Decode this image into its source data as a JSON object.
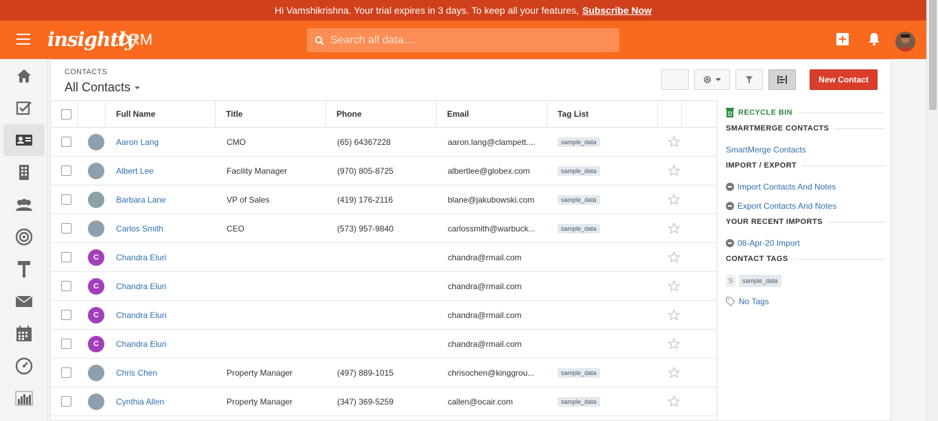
{
  "banner": {
    "message": "Hi Vamshikrishna. Your trial expires in 3 days. To keep all your features,",
    "cta": "Subscribe Now"
  },
  "header": {
    "logo": "insightly",
    "product": "CRM",
    "search_placeholder": "Search all data...."
  },
  "nav": {
    "items": [
      "home-icon",
      "tasks-icon",
      "contacts-icon",
      "organizations-icon",
      "leads-icon",
      "opportunities-icon",
      "projects-icon",
      "email-icon",
      "calendar-icon",
      "dashboard-icon",
      "reports-icon"
    ],
    "active": "contacts-icon"
  },
  "page": {
    "crumb": "CONTACTS",
    "view": "All Contacts",
    "new_button": "New Contact"
  },
  "table": {
    "columns": [
      "Full Name",
      "Title",
      "Phone",
      "Email",
      "Tag List"
    ],
    "rows": [
      {
        "name": "Aaron Lang",
        "title": "CMO",
        "phone": "(65) 64367228",
        "email": "aaron.lang@clampett....",
        "tag": "sample_data",
        "avatar": ""
      },
      {
        "name": "Albert Lee",
        "title": "Facility Manager",
        "phone": "(970) 805-8725",
        "email": "albertlee@globex.com",
        "tag": "sample_data",
        "avatar": ""
      },
      {
        "name": "Barbara Lane",
        "title": "VP of Sales",
        "phone": "(419) 176-2116",
        "email": "blane@jakubowski.com",
        "tag": "sample_data",
        "avatar": ""
      },
      {
        "name": "Carlos Smith",
        "title": "CEO",
        "phone": "(573) 957-9840",
        "email": "carlossmith@warbuck...",
        "tag": "sample_data",
        "avatar": ""
      },
      {
        "name": "Chandra Eluri",
        "title": "",
        "phone": "",
        "email": "chandra@rmail.com",
        "tag": "",
        "avatar": "C"
      },
      {
        "name": "Chandra Eluri",
        "title": "",
        "phone": "",
        "email": "chandra@rmail.com",
        "tag": "",
        "avatar": "C"
      },
      {
        "name": "Chandra Eluri",
        "title": "",
        "phone": "",
        "email": "chandra@rmail.com",
        "tag": "",
        "avatar": "C"
      },
      {
        "name": "Chandra Eluri",
        "title": "",
        "phone": "",
        "email": "chandra@rmail.com",
        "tag": "",
        "avatar": "C"
      },
      {
        "name": "Chris Chen",
        "title": "Property Manager",
        "phone": "(497) 889-1015",
        "email": "chrisochen@kinggrou...",
        "tag": "sample_data",
        "avatar": ""
      },
      {
        "name": "Cynthia Allen",
        "title": "Property Manager",
        "phone": "(347) 369-5259",
        "email": "callen@ocair.com",
        "tag": "sample_data",
        "avatar": ""
      }
    ]
  },
  "sidebar": {
    "recycle_bin": "RECYCLE BIN",
    "smartmerge_heading": "SMARTMERGE CONTACTS",
    "smartmerge_link": "SmartMerge Contacts",
    "import_export_heading": "IMPORT / EXPORT",
    "import_link": "Import Contacts And Notes",
    "export_link": "Export Contacts And Notes",
    "recent_imports_heading": "YOUR RECENT IMPORTS",
    "recent_import": "08-Apr-20 Import",
    "contact_tags_heading": "CONTACT TAGS",
    "tag_letter": "S",
    "tag_name": "sample_data",
    "no_tags": "No Tags"
  },
  "colors": {
    "banner": "#d0401a",
    "header": "#f96a1e",
    "primary_button": "#da3e2b",
    "link": "#2f6fb0",
    "letter_avatar": "#a33fba"
  }
}
